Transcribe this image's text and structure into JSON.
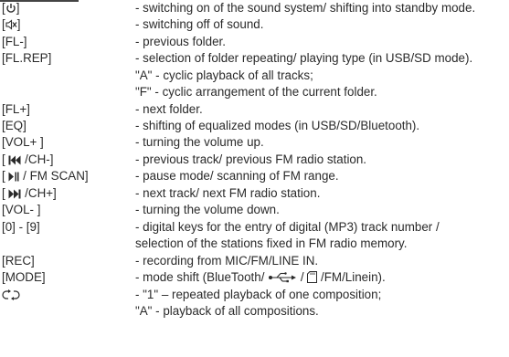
{
  "items": [
    {
      "key_open": "[",
      "icon": "power-icon",
      "key_close": "]",
      "desc": "- switching on of the sound system/ shifting into standby mode."
    },
    {
      "key_open": "[",
      "icon": "mute-icon",
      "key_close": "]",
      "desc": "- switching off of sound."
    },
    {
      "key": "[FL-]",
      "desc": "- previous folder."
    },
    {
      "key": "[FL.REP]",
      "desc": "- selection of folder repeating/ playing type (in USB/SD mode).",
      "sub": [
        "\"A\" - cyclic playback of all tracks;",
        "\"F\" - cyclic arrangement of the current folder."
      ]
    },
    {
      "key": "[FL+]",
      "desc": "- next folder."
    },
    {
      "key": "[EQ]",
      "desc": "- shifting of equalized modes (in USB/SD/Bluetooth)."
    },
    {
      "key": "[VOL+ ]",
      "desc": "- turning the volume up."
    },
    {
      "key_open": "[ ",
      "icon": "skip-previous-icon",
      "key_suffix": " /CH-]",
      "desc": "- previous track/ previous FM radio station."
    },
    {
      "key_open": "[ ",
      "icon": "play-pause-icon",
      "key_suffix": " / FM SCAN]",
      "desc": "- pause mode/ scanning of FM range."
    },
    {
      "key_open": "[ ",
      "icon": "skip-next-icon",
      "key_suffix": " /CH+]",
      "desc": "- next track/ next FM radio station."
    },
    {
      "key": "[VOL- ]",
      "desc": "- turning the volume down."
    },
    {
      "key": "[0] - [9]",
      "desc": "- digital keys for the entry of digital (MP3) track number /",
      "desc_cont": "selection of the stations fixed in FM radio memory."
    },
    {
      "key": "[REC]",
      "desc": "- recording from MIC/FM/LINE IN."
    },
    {
      "key": "[MODE]",
      "desc_pre": "- mode shift (BlueTooth/ ",
      "icon_usb": "usb-icon",
      "desc_mid": " / ",
      "icon_sd": "sd-card-icon",
      "desc_post": " /FM/Linein)."
    },
    {
      "icon": "repeat-icon",
      "desc": "- \"1\" – repeated playback of one composition;",
      "sub": [
        "\"A\" - playback of all compositions."
      ]
    }
  ]
}
